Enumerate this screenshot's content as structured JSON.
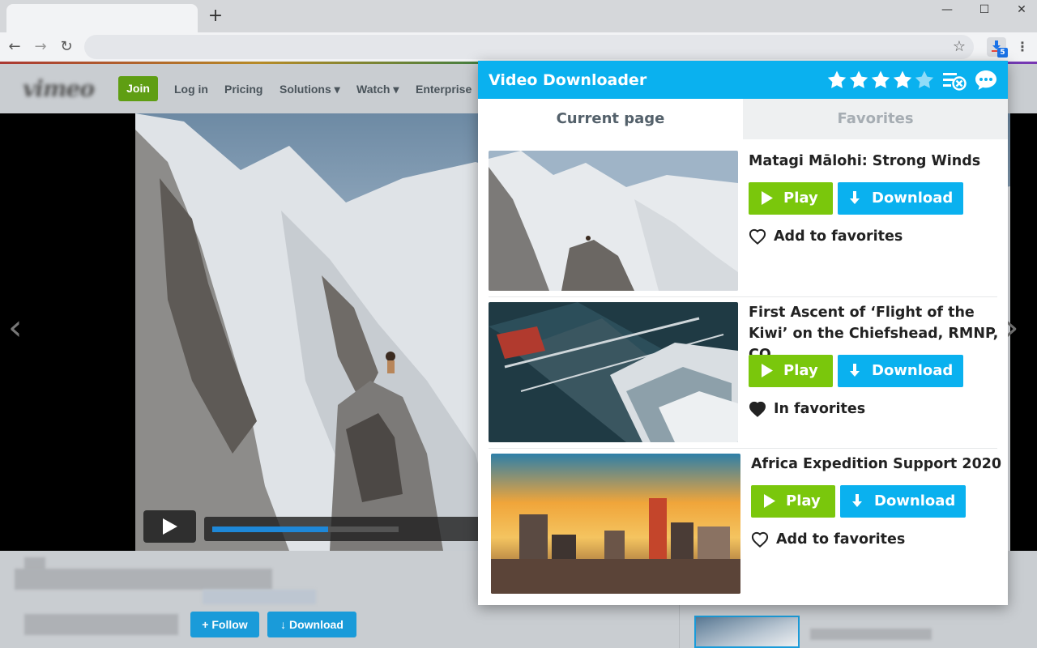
{
  "browser": {
    "new_tab_glyph": "+",
    "minimize_glyph": "—",
    "maximize_glyph": "☐",
    "close_glyph": "✕",
    "back_glyph": "←",
    "forward_glyph": "→",
    "reload_glyph": "↻",
    "address_value": "",
    "bookmark_glyph": "☆",
    "extension_badge": "5",
    "menu_glyph": "⋮"
  },
  "site": {
    "logo": "vimeo",
    "join": "Join",
    "nav": [
      "Log in",
      "Pricing",
      "Solutions ▾",
      "Watch ▾",
      "Enterprise"
    ],
    "prev_glyph": "‹",
    "next_glyph": "›",
    "player_progress": 0.62,
    "follow": "+ Follow",
    "download": "↓ Download"
  },
  "popup": {
    "title": "Video Downloader",
    "rating": 4.5,
    "rating_max": 5,
    "icons": [
      "star-icon",
      "clear-list-icon",
      "chat-bubble-icon"
    ],
    "colors": {
      "accent": "#0ab1ef",
      "play": "#7ac70c"
    },
    "tabs": {
      "current": "Current page",
      "favorites": "Favorites"
    },
    "videos": [
      {
        "title": "Matagi Mālohi: Strong Winds",
        "play": "Play",
        "download": "Download",
        "favorite_label": "Add to favorites",
        "favorited": false
      },
      {
        "title": "First Ascent of ‘Flight of the Kiwi’ on the Chiefshead, RMNP, CO",
        "play": "Play",
        "download": "Download",
        "favorite_label": "In favorites",
        "favorited": true
      },
      {
        "title": "Africa Expedition Support 2020",
        "play": "Play",
        "download": "Download",
        "favorite_label": "Add to favorites",
        "favorited": false
      }
    ]
  }
}
